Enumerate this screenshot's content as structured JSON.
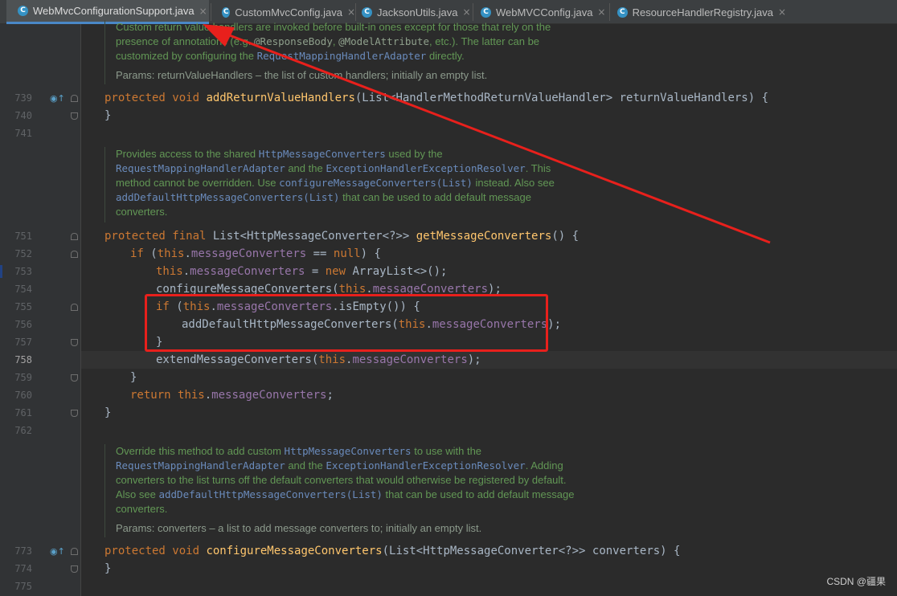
{
  "tabs": [
    {
      "label": "WebMvcConfigurationSupport.java",
      "active": true
    },
    {
      "label": "CustomMvcConfig.java",
      "active": false
    },
    {
      "label": "JacksonUtils.java",
      "active": false
    },
    {
      "label": "WebMVCConfig.java",
      "active": false
    },
    {
      "label": "ResourceHandlerRegistry.java",
      "active": false
    }
  ],
  "line_numbers": [
    "739",
    "740",
    "741",
    "751",
    "752",
    "753",
    "754",
    "755",
    "756",
    "757",
    "758",
    "759",
    "760",
    "761",
    "762",
    "773",
    "774",
    "775"
  ],
  "doc1": {
    "line1": "Custom return value handlers are invoked before built-in ones except for those that rely on the",
    "line2a": "presence of annotations (e.g. ",
    "line2b": "@ResponseBody",
    "line2c": ", ",
    "line2d": "@ModelAttribute",
    "line2e": ", etc.). The latter can be",
    "line3a": "customized by configuring the ",
    "line3b": "RequestMappingHandlerAdapter",
    "line3c": " directly.",
    "params": "Params: returnValueHandlers – the list of custom handlers; initially an empty list."
  },
  "code739": {
    "kw": "protected void ",
    "fn": "addReturnValueHandlers",
    "rest": "(List<HandlerMethodReturnValueHandler> returnValueHandlers) {"
  },
  "code740": "}",
  "doc2": {
    "l1a": "Provides access to the shared ",
    "l1b": "HttpMessageConverters",
    "l1c": " used by the",
    "l2a": "RequestMappingHandlerAdapter",
    "l2b": " and the ",
    "l2c": "ExceptionHandlerExceptionResolver",
    "l2d": ". This",
    "l3a": "method cannot be overridden. Use ",
    "l3b": "configureMessageConverters(List)",
    "l3c": " instead. Also see",
    "l4a": "addDefaultHttpMessageConverters(List)",
    "l4b": " that can be used to add default message",
    "l5": "converters."
  },
  "code751": {
    "kw": "protected final ",
    "type": "List<HttpMessageConverter<?>> ",
    "fn": "getMessageConverters",
    "rest": "() {"
  },
  "code752": {
    "kw": "if ",
    "p1": "(",
    "this": "this",
    "dot": ".",
    "fld": "messageConverters",
    "op": " == ",
    "nul": "null",
    "rest": ") {"
  },
  "code753": {
    "this": "this",
    "dot": ".",
    "fld": "messageConverters",
    "op": " = ",
    "kw": "new ",
    "rest": "ArrayList<>();"
  },
  "code754": {
    "pre": "configureMessageConverters(",
    "this": "this",
    "dot": ".",
    "fld": "messageConverters",
    "rest": ");"
  },
  "code755": {
    "kw": "if ",
    "p1": "(",
    "this": "this",
    "dot": ".",
    "fld": "messageConverters",
    "rest": ".isEmpty()) {"
  },
  "code756": {
    "pre": "addDefaultHttpMessageConverters(",
    "this": "this",
    "dot": ".",
    "fld": "messageConverters",
    "rest": ");"
  },
  "code757": "}",
  "code758": {
    "pre": "extendMessageConverters(",
    "this": "this",
    "dot": ".",
    "fld": "messageConverters",
    "rest": ");"
  },
  "code759": "}",
  "code760": {
    "kw": "return ",
    "this": "this",
    "dot": ".",
    "fld": "messageConverters",
    "rest": ";"
  },
  "code761": "}",
  "doc3": {
    "l1a": "Override this method to add custom ",
    "l1b": "HttpMessageConverters",
    "l1c": " to use with the",
    "l2a": "RequestMappingHandlerAdapter",
    "l2b": " and the ",
    "l2c": "ExceptionHandlerExceptionResolver",
    "l2d": ". Adding",
    "l3": "converters to the list turns off the default converters that would otherwise be registered by default.",
    "l4a": "Also see ",
    "l4b": "addDefaultHttpMessageConverters(List)",
    "l4c": " that can be used to add default message",
    "l5": "converters.",
    "params": "Params: converters – a list to add message converters to; initially an empty list."
  },
  "code773": {
    "kw": "protected void ",
    "fn": "configureMessageConverters",
    "rest": "(List<HttpMessageConverter<?>> converters) {"
  },
  "code774": "}",
  "watermark": "CSDN @疆果",
  "colors": {
    "annotation_red": "#e8201c",
    "keyword": "#cc7832",
    "method": "#ffc66d",
    "field": "#9876aa",
    "doc": "#629755"
  }
}
